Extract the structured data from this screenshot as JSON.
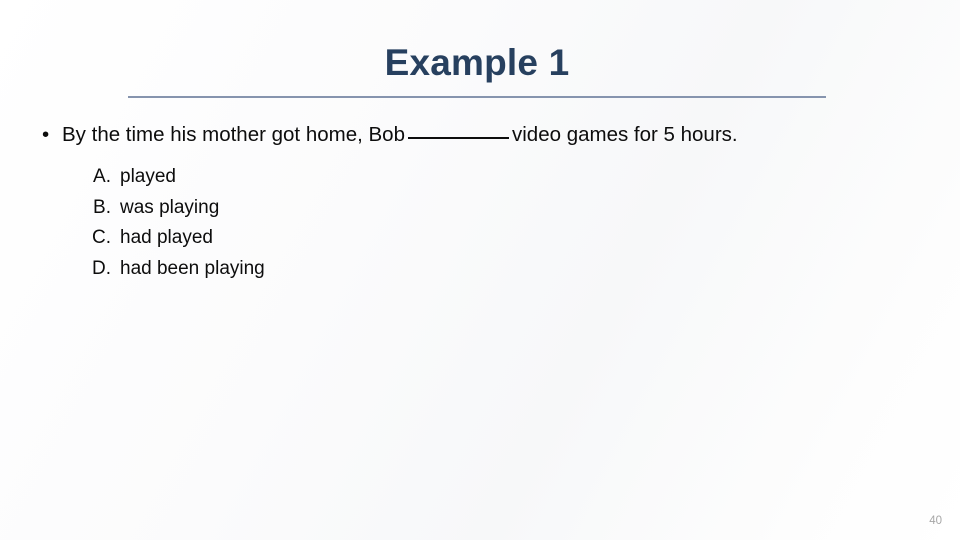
{
  "slide": {
    "title": "Example 1",
    "page_number": "40",
    "colors": {
      "title": "#27405f",
      "rule": "#8694ae",
      "body_text": "#0d0d0d",
      "page_number": "#a6a6a6",
      "background": "#fbfbfc"
    }
  },
  "question": {
    "bullet_marker": "•",
    "text_before_blank": "By the time his mother got home, Bob",
    "blank": "____",
    "text_after_blank": "video games for 5 hours."
  },
  "options": [
    {
      "letter": "A.",
      "text": "played"
    },
    {
      "letter": "B.",
      "text": "was playing"
    },
    {
      "letter": "C.",
      "text": "had played"
    },
    {
      "letter": "D.",
      "text": "had been playing"
    }
  ]
}
